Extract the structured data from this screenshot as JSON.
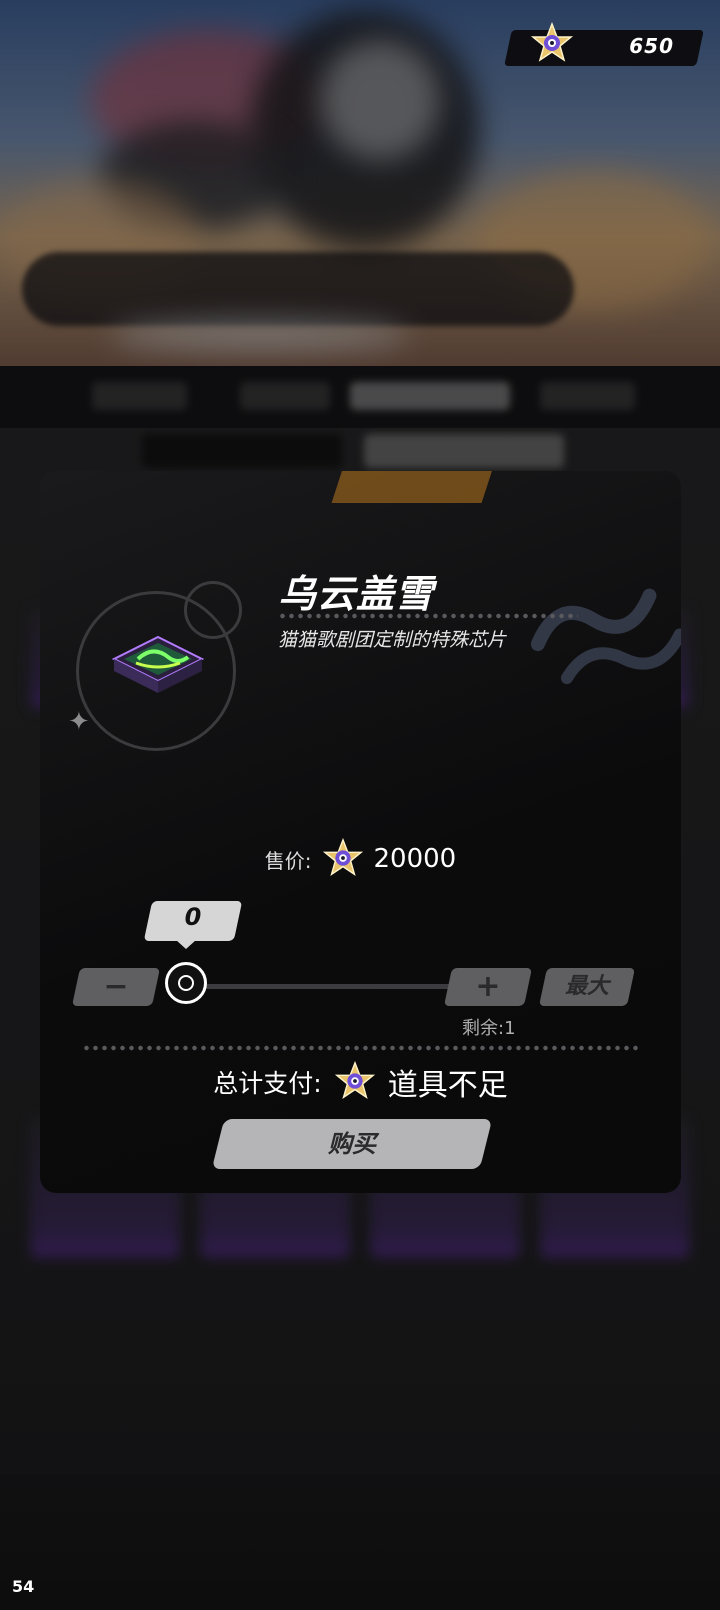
{
  "header": {
    "currency_value": "650",
    "currency_icon": "star-coin-icon"
  },
  "dialog": {
    "item_name": "乌云盖雪",
    "item_description": "猫猫歌剧团定制的特殊芯片",
    "price_label": "售价:",
    "price_value": "20000",
    "quantity": "0",
    "minus_label": "−",
    "plus_label": "+",
    "max_label": "最大",
    "remaining_label": "剩余:1",
    "total_label": "总计支付:",
    "total_value": "道具不足",
    "buy_label": "购买"
  },
  "overlay": {
    "fps": "54"
  },
  "colors": {
    "dialog_bg": "#0b0b0c",
    "button_gray": "#5f5f62",
    "buy_button": "#b5b5b7",
    "star_gold": "#e9c46a",
    "star_core": "#6f4fd8"
  }
}
